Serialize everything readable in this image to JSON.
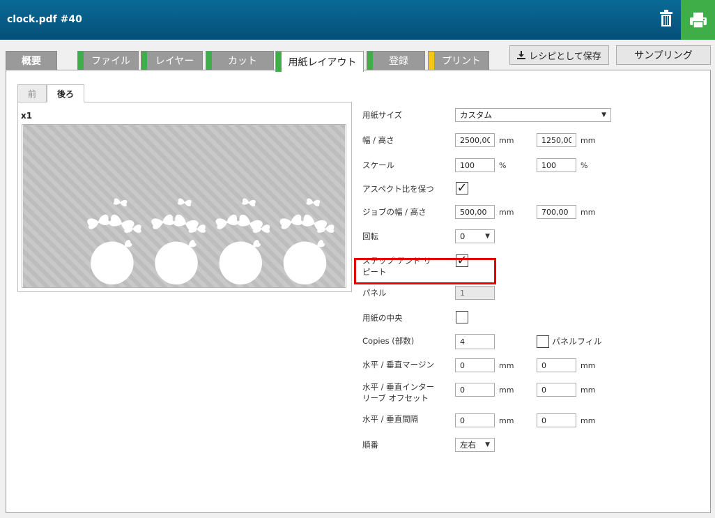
{
  "header": {
    "title": "clock.pdf #40",
    "trash_icon": "trash-icon",
    "print_icon": "print-icon",
    "print_color": "#3fae49"
  },
  "tabs": [
    {
      "label": "概要",
      "marker": null
    },
    {
      "label": "ファイル",
      "marker": "#3fae49"
    },
    {
      "label": "レイヤー",
      "marker": "#3fae49"
    },
    {
      "label": "カット",
      "marker": "#3fae49"
    },
    {
      "label": "用紙レイアウト",
      "marker": "#3fae49"
    },
    {
      "label": "登録",
      "marker": "#3fae49"
    },
    {
      "label": "プリント",
      "marker": "#f5c518"
    }
  ],
  "actions": {
    "save_recipe": "レシピとして保存",
    "sampling": "サンプリング"
  },
  "subtabs": {
    "front": "前",
    "back": "後ろ"
  },
  "preview": {
    "scale": "x1"
  },
  "form": {
    "paper_size": {
      "label": "用紙サイズ",
      "value": "カスタム"
    },
    "width_height": {
      "label": "幅 / 高さ",
      "width": "2500,00",
      "height": "1250,00",
      "unit": "mm"
    },
    "scale": {
      "label": "スケール",
      "x": "100",
      "y": "100",
      "unit": "%"
    },
    "keep_aspect": {
      "label": "アスペクト比を保つ",
      "checked": true
    },
    "job_size": {
      "label": "ジョブの幅 / 高さ",
      "width": "500,00",
      "height": "700,00",
      "unit": "mm"
    },
    "rotation": {
      "label": "回転",
      "value": "0"
    },
    "step_repeat": {
      "label_line1": "ステップ アンド リ",
      "label_line2": "ピート",
      "checked": true
    },
    "panels": {
      "label": "パネル",
      "value": "1"
    },
    "center": {
      "label": "用紙の中央",
      "checked": false
    },
    "copies": {
      "label": "Copies (部数)",
      "value": "4"
    },
    "panel_fill": {
      "label": "パネルフィル",
      "checked": false
    },
    "margins": {
      "label": "水平 / 垂直マージン",
      "h": "0",
      "v": "0",
      "unit": "mm"
    },
    "interleave": {
      "label_line1": "水平 / 垂直インター",
      "label_line2": "リーブ オフセット",
      "h": "0",
      "v": "0",
      "unit": "mm"
    },
    "spacing": {
      "label": "水平 / 垂直間隔",
      "h": "0",
      "v": "0",
      "unit": "mm"
    },
    "order": {
      "label": "順番",
      "value": "左右"
    }
  }
}
